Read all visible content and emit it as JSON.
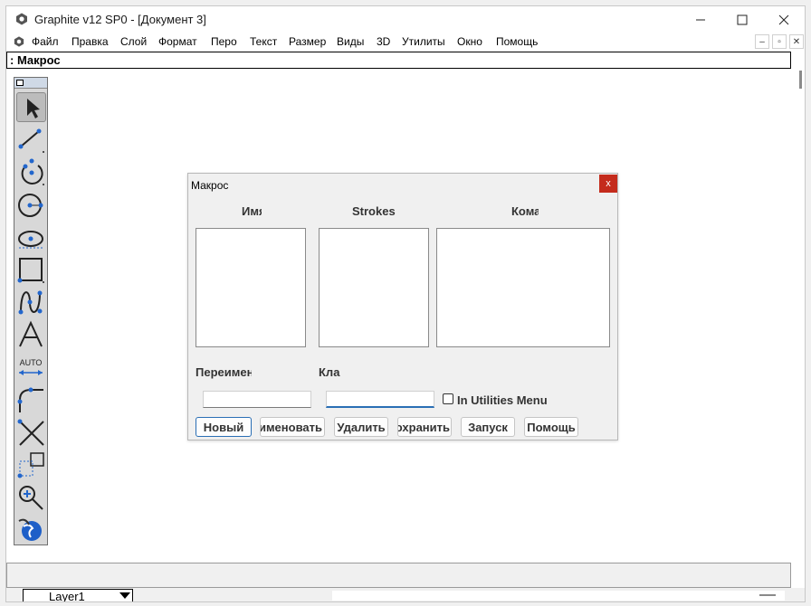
{
  "window": {
    "title": "Graphite v12 SP0 - [Документ 3]"
  },
  "menu": {
    "items": [
      "Файл",
      "Правка",
      "Слой",
      "Формат",
      "Перо",
      "Текст",
      "Размер",
      "Виды",
      "3D",
      "Утилиты",
      "Окно",
      "Помощь"
    ]
  },
  "cmdline": {
    "text": ": Макрос"
  },
  "dialog": {
    "title": "Макрос",
    "close": "x",
    "columns": [
      "Имя",
      "Strokes",
      "Команды"
    ],
    "rename_label": "Переименовать",
    "key_label": "Клавиши",
    "rename_value": "",
    "key_value": "",
    "utilities_checkbox_label": "In Utilities Menu",
    "utilities_checked": false,
    "buttons": [
      "Новый",
      "Переименовать",
      "Удалить",
      "Сохранить",
      "Запуск",
      "Помощь"
    ]
  },
  "tools": [
    "select-arrow-icon",
    "line-icon",
    "arc-icon",
    "circle-icon",
    "ellipse-icon",
    "rectangle-icon",
    "spline-icon",
    "text-icon",
    "auto-dimension-icon",
    "fillet-icon",
    "trim-icon",
    "snap-box-icon",
    "zoom-icon",
    "globe-view-icon"
  ],
  "tool_auto_label": "AUTO",
  "status": {
    "layer": "Layer1"
  },
  "colors": {
    "accent": "#2a6fb5",
    "close_red": "#c42b1c",
    "handle_blue": "#2266cc"
  }
}
